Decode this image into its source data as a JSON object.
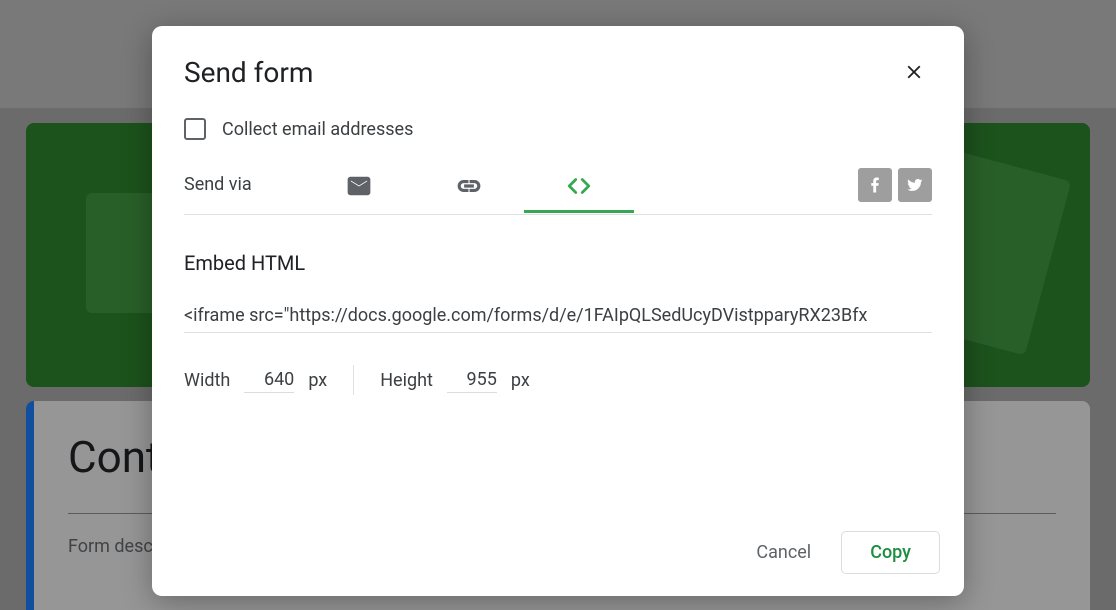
{
  "background": {
    "title_snippet": "Cont",
    "desc_label": "Form desc"
  },
  "dialog": {
    "title": "Send form",
    "collect_email_label": "Collect email addresses",
    "collect_email_checked": false,
    "send_via_label": "Send via",
    "tabs": {
      "email": "email-icon",
      "link": "link-icon",
      "embed": "embed-icon",
      "active": "embed"
    },
    "social": {
      "facebook": "facebook-icon",
      "twitter": "twitter-icon"
    },
    "embed_section": {
      "label": "Embed HTML",
      "code": "<iframe src=\"https://docs.google.com/forms/d/e/1FAIpQLSedUcyDVistpparyRX23Bfx"
    },
    "dimensions": {
      "width_label": "Width",
      "width_value": "640",
      "height_label": "Height",
      "height_value": "955",
      "unit": "px"
    },
    "buttons": {
      "cancel": "Cancel",
      "copy": "Copy"
    },
    "colors": {
      "accent_green": "#34a853",
      "copy_green": "#1e8e3e"
    }
  }
}
